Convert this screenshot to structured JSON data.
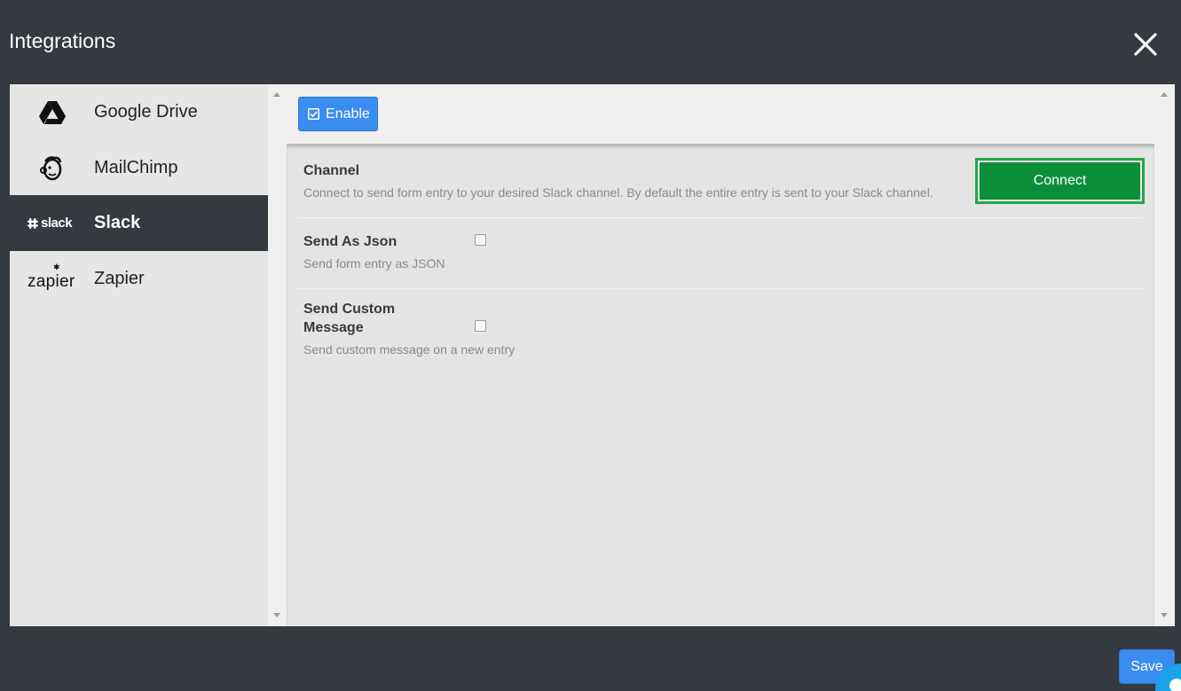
{
  "window": {
    "title": "Integrations",
    "close_icon": "close-icon"
  },
  "sidebar": {
    "items": [
      {
        "label": "Google Drive",
        "icon": "google-drive-icon",
        "active": false
      },
      {
        "label": "MailChimp",
        "icon": "mailchimp-icon",
        "active": false
      },
      {
        "label": "Slack",
        "icon": "slack-logo",
        "logo_text": "slack",
        "active": true
      },
      {
        "label": "Zapier",
        "icon": "zapier-logo",
        "logo_text": "zapier",
        "active": false
      }
    ]
  },
  "content": {
    "enable_button": {
      "label": "Enable",
      "icon": "checkbox-checked-icon"
    },
    "settings": [
      {
        "title": "Channel",
        "description": "Connect to send form entry to your desired Slack channel. By default the entire entry is sent to your Slack channel.",
        "control": "button",
        "button_label": "Connect"
      },
      {
        "title": "Send As Json",
        "description": "Send form entry as JSON",
        "control": "checkbox",
        "checked": false
      },
      {
        "title": "Send Custom Message",
        "description": "Send custom message on a new entry",
        "control": "checkbox",
        "checked": false
      }
    ]
  },
  "footer": {
    "save_label": "Save"
  },
  "colors": {
    "dark_background": "#343a40",
    "primary_blue": "#3b8cf0",
    "connect_green": "#0d8f3a",
    "connect_border": "#23a84a",
    "chat_blue": "#1aa3e8"
  }
}
